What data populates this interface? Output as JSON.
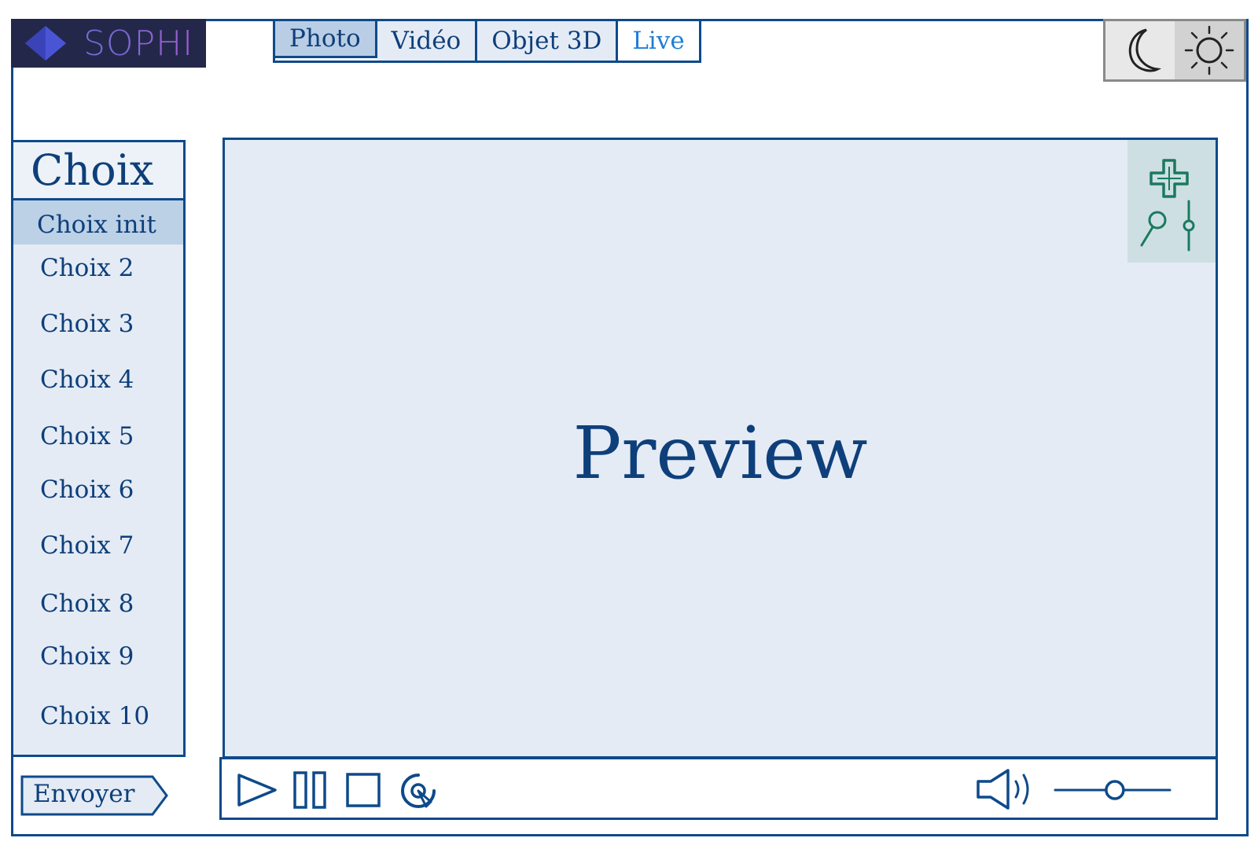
{
  "logo": {
    "text": "SOPHI"
  },
  "tabs": [
    {
      "label": "Photo",
      "active": true
    },
    {
      "label": "Vidéo",
      "active": false
    },
    {
      "label": "Objet 3D",
      "active": false
    },
    {
      "label": "Live",
      "active": false
    }
  ],
  "theme": {
    "options": [
      "moon-icon",
      "sun-icon"
    ]
  },
  "sidebar": {
    "title": "Choix",
    "items": [
      {
        "label": "Choix init",
        "selected": true
      },
      {
        "label": "Choix 2"
      },
      {
        "label": "Choix 3"
      },
      {
        "label": "Choix 4"
      },
      {
        "label": "Choix 5"
      },
      {
        "label": "Choix 6"
      },
      {
        "label": "Choix 7"
      },
      {
        "label": "Choix 8"
      },
      {
        "label": "Choix 9"
      },
      {
        "label": "Choix 10"
      }
    ]
  },
  "send_button": {
    "label": "Envoyer"
  },
  "preview": {
    "label": "Preview"
  },
  "tools": [
    "move-icon",
    "zoom-icon",
    "adjust-slider-icon"
  ],
  "controls": {
    "buttons": [
      "play-icon",
      "pause-icon",
      "stop-icon",
      "replay-icon"
    ],
    "volume_icon": "volume-icon",
    "volume_level": 0.52
  },
  "colors": {
    "primary": "#0e4a8a",
    "panel": "#e4ebf5",
    "selected": "#bcd0e6",
    "tool_accent": "#1a7a5e",
    "logo_bg": "#23284a"
  }
}
